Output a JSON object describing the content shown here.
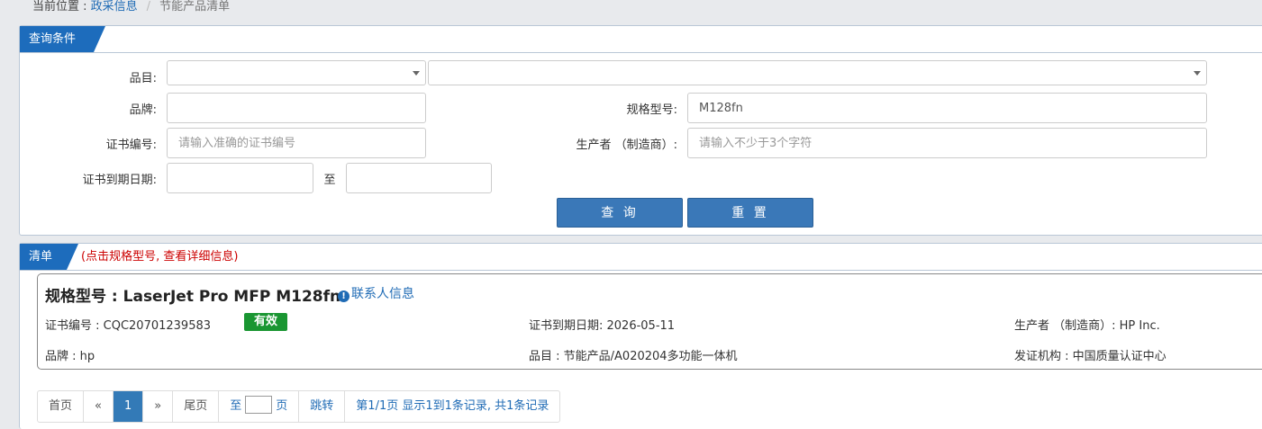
{
  "breadcrumb": {
    "prefix": "当前位置 : ",
    "link": "政采信息",
    "separator": "/",
    "current": "节能产品清单"
  },
  "query_panel": {
    "tab_label": "查询条件",
    "category_label": "品目:",
    "brand_label": "品牌:",
    "model_label": "规格型号:",
    "model_value": "M128fn",
    "cert_no_label": "证书编号:",
    "cert_no_placeholder": "请输入准确的证书编号",
    "manufacturer_label": "生产者 （制造商）:",
    "manufacturer_placeholder": "请输入不少于3个字符",
    "expiry_label": "证书到期日期:",
    "to_label": "至",
    "search_button": "查 询",
    "reset_button": "重 置"
  },
  "list_panel": {
    "tab_label": "清单",
    "hint": "(点击规格型号, 查看详细信息)",
    "result": {
      "title": "规格型号 : LaserJet Pro MFP M128fn",
      "contact_label": "联系人信息",
      "cert_no": "证书编号 : CQC20701239583",
      "status": "有效",
      "expiry": "证书到期日期: 2026-05-11",
      "manufacturer": "生产者 （制造商）: HP Inc.",
      "brand": "品牌 : hp",
      "category": "品目 : 节能产品/A020204多功能一体机",
      "issuer": "发证机构 : 中国质量认证中心"
    }
  },
  "pagination": {
    "first": "首页",
    "prev": "«",
    "current": "1",
    "next": "»",
    "last": "尾页",
    "goto_prefix": "至",
    "goto_suffix": "页",
    "jump": "跳转",
    "summary": "第1/1页  显示1到1条记录, 共1条记录"
  },
  "colors": {
    "accent": "#1d6cbc",
    "status_valid": "#1a9632",
    "hint": "#cc0000"
  }
}
